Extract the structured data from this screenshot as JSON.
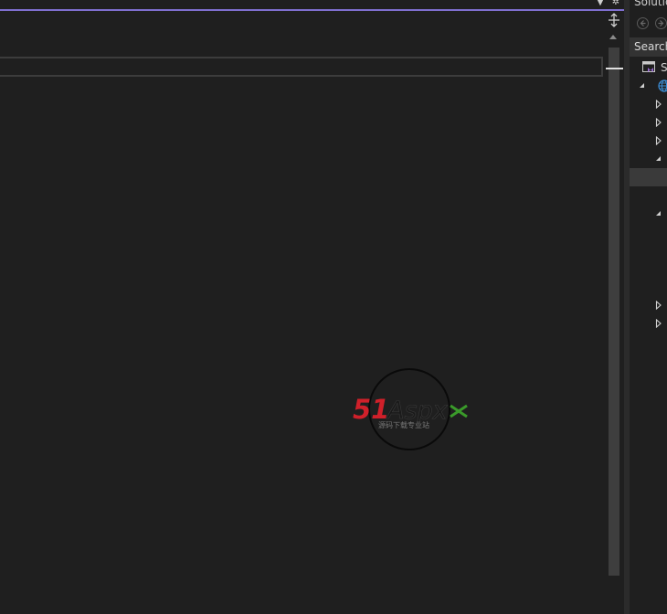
{
  "solution_explorer": {
    "title": "Solutio",
    "search_placeholder": "Search",
    "solution_initial": "S"
  },
  "watermark": {
    "brand_number": "51",
    "brand_text": "Aspx",
    "brand_sub": "源码下载专业站"
  },
  "colors": {
    "editor_background": "#1f1f1f",
    "accent_line": "#7f6fd0",
    "watermark_red": "#d0202a",
    "watermark_green": "#3a9a2a"
  },
  "icons": {
    "tab_menu": "chevron-down-icon",
    "settings": "gear-icon",
    "split": "split-editor-icon",
    "back": "arrow-left-icon",
    "forward": "arrow-right-icon",
    "solution": "visual-studio-solution-icon",
    "web_project": "globe-icon"
  }
}
